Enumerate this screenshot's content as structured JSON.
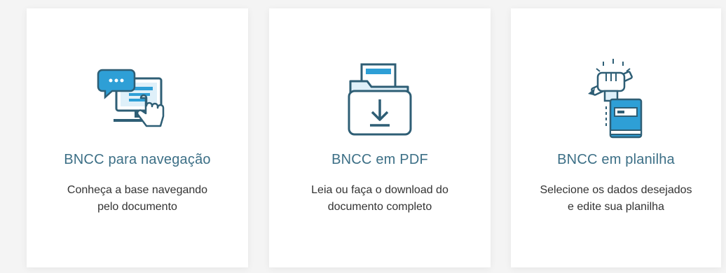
{
  "colors": {
    "page_background": "#f4f4f4",
    "card_background": "#ffffff",
    "title_color": "#3c6f86",
    "icon_blue": "#2e9fd6",
    "icon_dark": "#2e5e75",
    "text_color": "#333333"
  },
  "cards": [
    {
      "icon": "computer-chat-hand-icon",
      "title": "BNCC para navegação",
      "description_lines": [
        "Conheça a base navegando",
        "pelo documento"
      ]
    },
    {
      "icon": "folder-download-icon",
      "title": "BNCC em PDF",
      "description_lines": [
        "Leia ou faça o download do",
        "documento completo"
      ]
    },
    {
      "icon": "hand-pen-book-icon",
      "title": "BNCC em planilha",
      "description_lines": [
        "Selecione os dados desejados",
        "e edite sua planilha"
      ]
    }
  ]
}
